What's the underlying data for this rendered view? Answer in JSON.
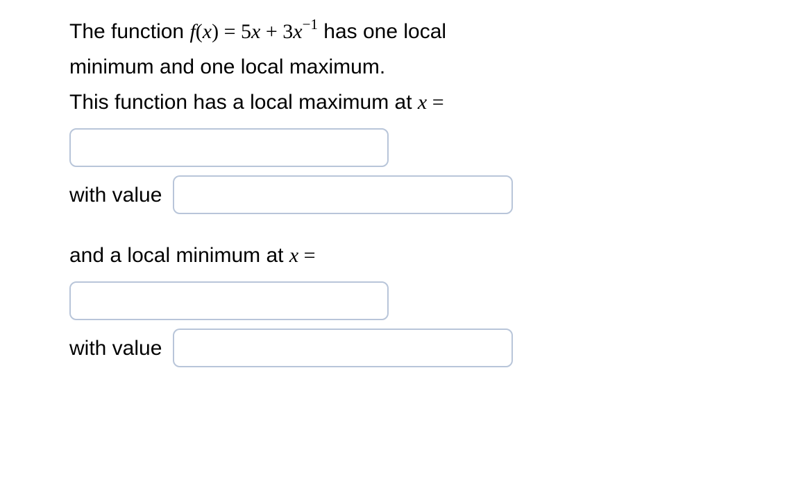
{
  "problem": {
    "part1": "The function ",
    "func_lhs": "f",
    "lparen": "(",
    "var_x": "x",
    "rparen": ")",
    "equals": " = ",
    "term1_coef": "5",
    "term1_var": "x",
    "plus": " + ",
    "term2_coef": "3",
    "term2_var": "x",
    "exp_neg": "−",
    "exp_num": "1",
    "part2": " has one local",
    "line2": "minimum and one local maximum.",
    "line3": "This function has a local maximum at ",
    "x_equals": "x",
    "eq_sign": " = ",
    "with_value": "with value",
    "local_min": "and a local minimum at ",
    "x_equals2": "x",
    "eq_sign2": " = "
  }
}
